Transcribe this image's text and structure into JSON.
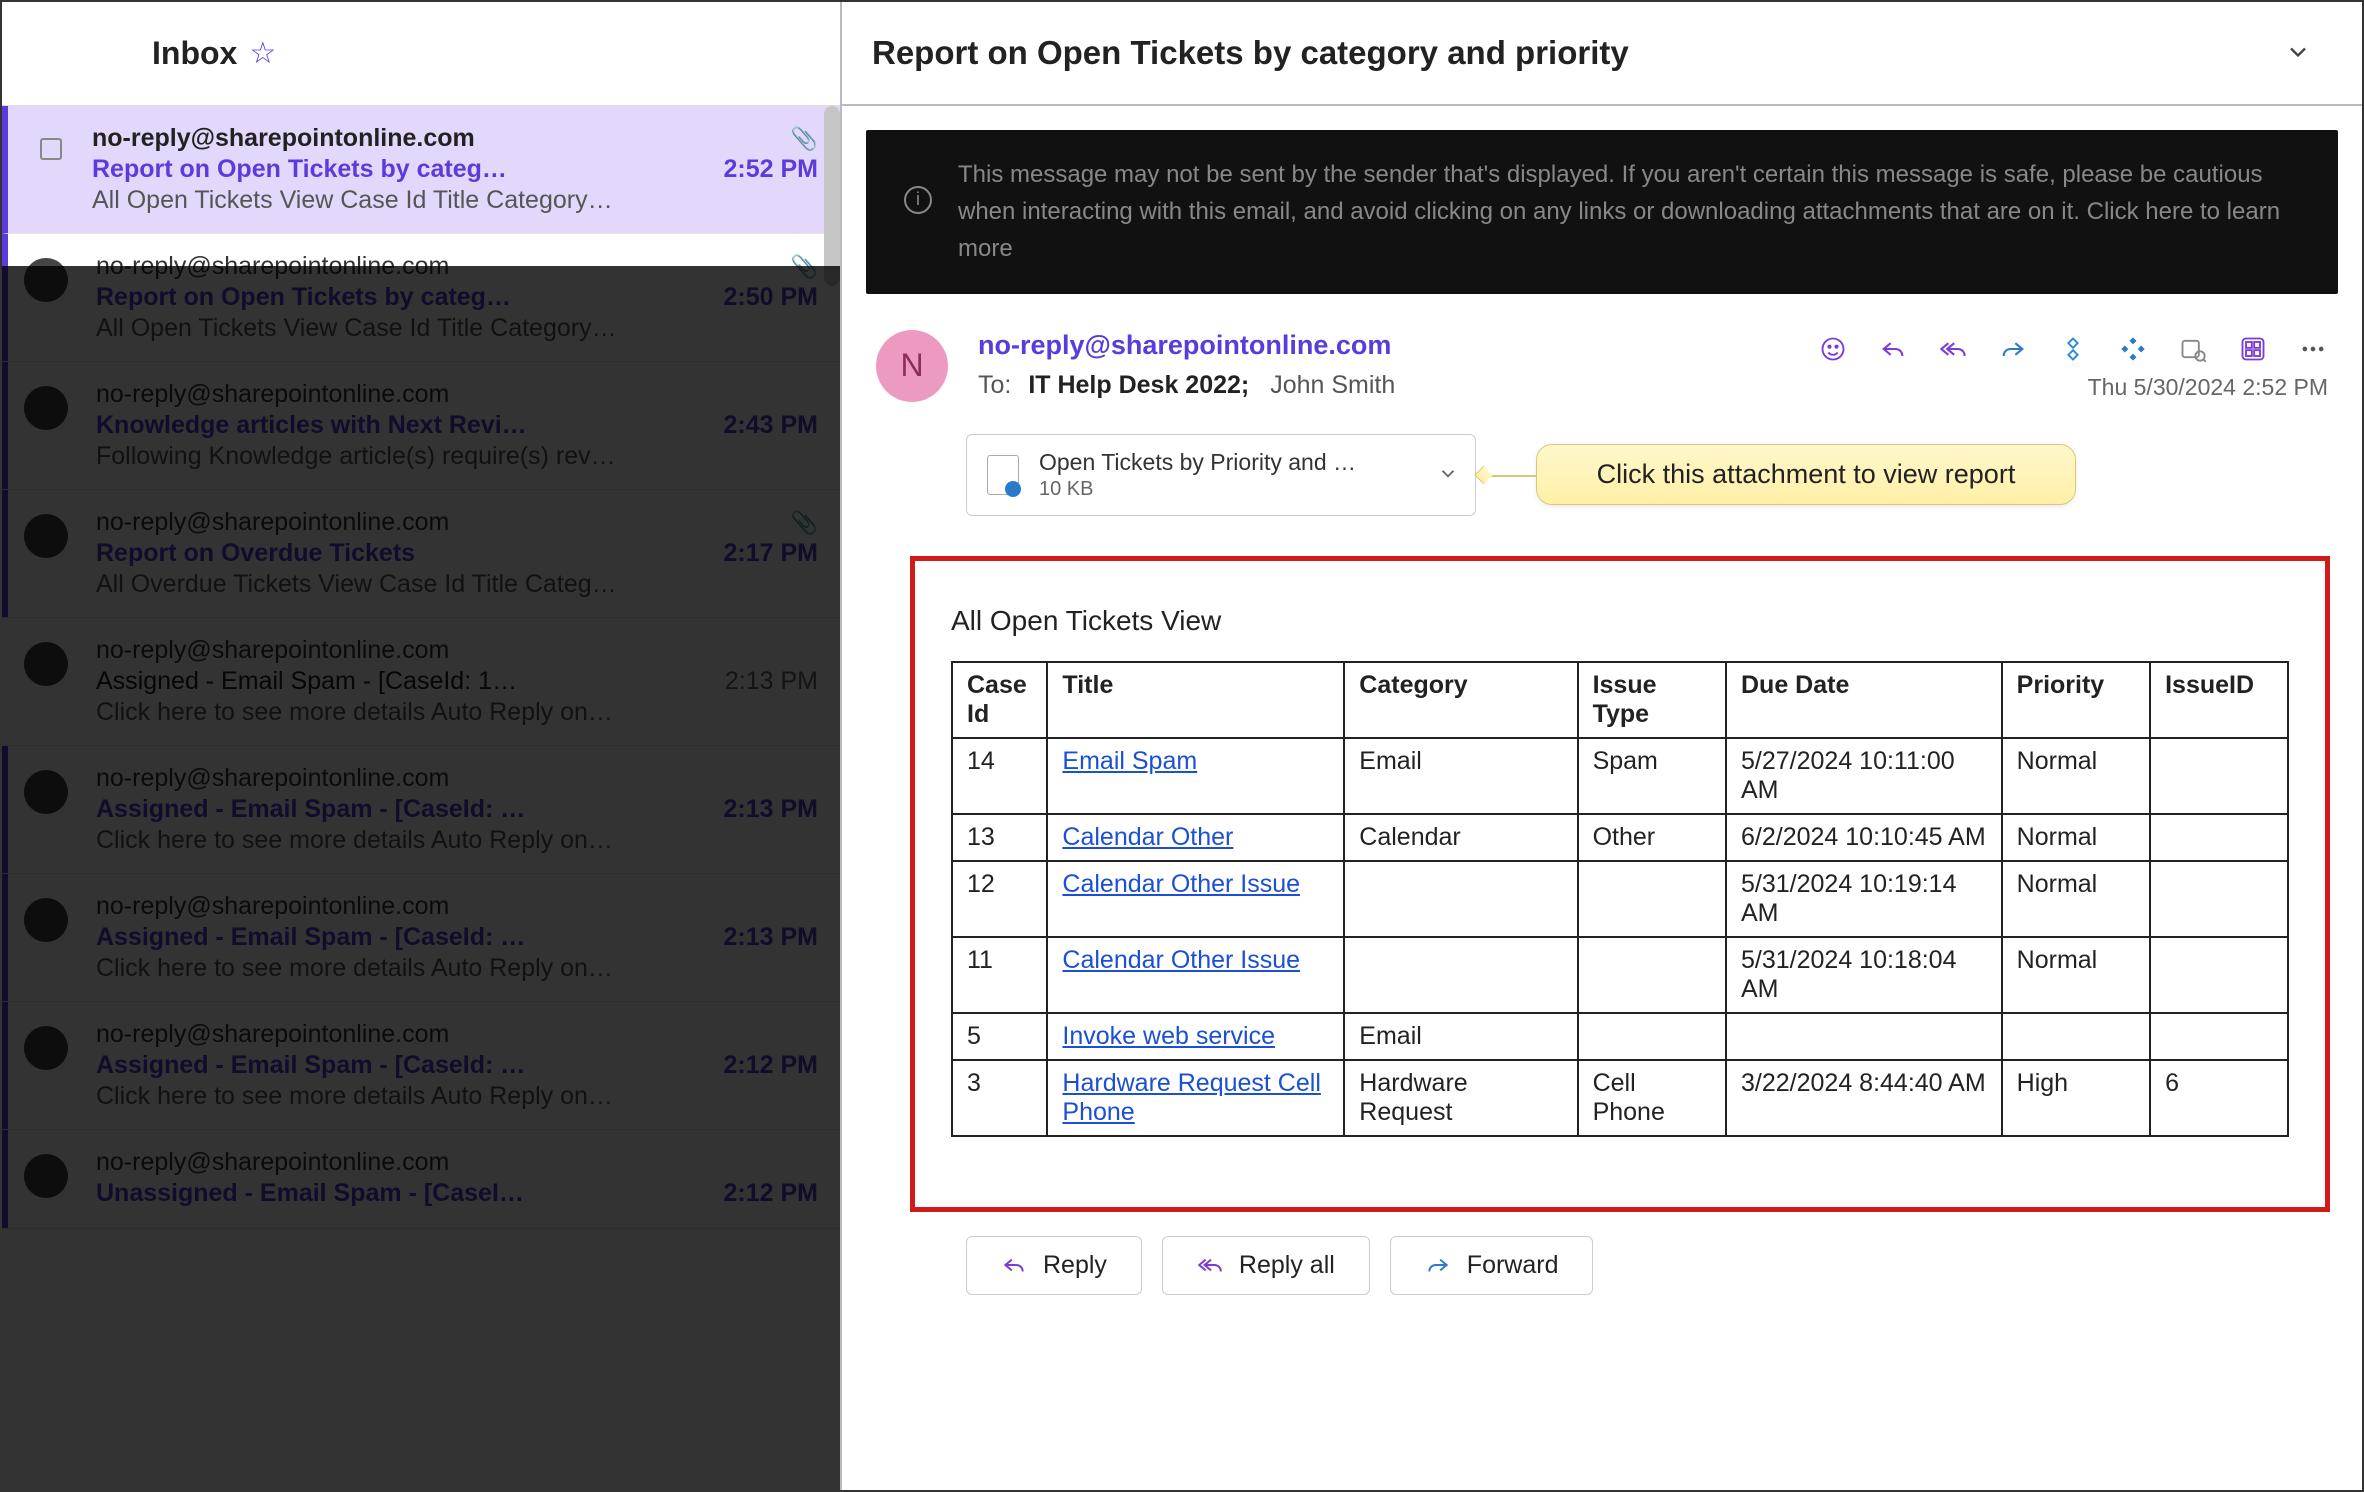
{
  "inbox": {
    "title": "Inbox",
    "items": [
      {
        "sender": "no-reply@sharepointonline.com",
        "subject": "Report on Open Tickets by categ…",
        "time": "2:52 PM",
        "preview": "All Open Tickets View Case Id Title Category…",
        "hasAttach": true,
        "selected": true,
        "unread": true
      },
      {
        "sender": "no-reply@sharepointonline.com",
        "subject": "Report on Open Tickets by categ…",
        "time": "2:50 PM",
        "preview": "All Open Tickets View Case Id Title Category…",
        "hasAttach": true,
        "selected": false,
        "unread": true
      },
      {
        "sender": "no-reply@sharepointonline.com",
        "subject": "Knowledge articles with Next Revi…",
        "time": "2:43 PM",
        "preview": "Following Knowledge article(s) require(s) rev…",
        "hasAttach": false,
        "selected": false,
        "unread": true
      },
      {
        "sender": "no-reply@sharepointonline.com",
        "subject": "Report on Overdue Tickets",
        "time": "2:17 PM",
        "preview": "All Overdue Tickets View Case Id Title Categ…",
        "hasAttach": true,
        "selected": false,
        "unread": true
      },
      {
        "sender": "no-reply@sharepointonline.com",
        "subject": "Assigned - Email Spam - [CaseId: 1…",
        "time": "2:13 PM",
        "preview": "Click here to see more details Auto Reply on…",
        "hasAttach": false,
        "selected": false,
        "unread": false
      },
      {
        "sender": "no-reply@sharepointonline.com",
        "subject": "Assigned - Email Spam - [CaseId: …",
        "time": "2:13 PM",
        "preview": "Click here to see more details Auto Reply on…",
        "hasAttach": false,
        "selected": false,
        "unread": true
      },
      {
        "sender": "no-reply@sharepointonline.com",
        "subject": "Assigned - Email Spam - [CaseId: …",
        "time": "2:13 PM",
        "preview": "Click here to see more details Auto Reply on…",
        "hasAttach": false,
        "selected": false,
        "unread": true
      },
      {
        "sender": "no-reply@sharepointonline.com",
        "subject": "Assigned - Email Spam - [CaseId: …",
        "time": "2:12 PM",
        "preview": "Click here to see more details Auto Reply on…",
        "hasAttach": false,
        "selected": false,
        "unread": true
      },
      {
        "sender": "no-reply@sharepointonline.com",
        "subject": "Unassigned - Email Spam - [CaseI…",
        "time": "2:12 PM",
        "preview": "",
        "hasAttach": false,
        "selected": false,
        "unread": true
      }
    ]
  },
  "reading": {
    "subject": "Report on Open Tickets by category and priority",
    "safety_banner": "This message may not be sent by the sender that's displayed. If you aren't certain this message is safe, please be cautious when interacting with this email, and avoid clicking on any links or downloading attachments that are on it.  Click here to learn more",
    "sender_initial": "N",
    "sender_addr": "no-reply@sharepointonline.com",
    "to_label": "To:",
    "to_primary": "IT Help Desk 2022;",
    "to_secondary": "John Smith",
    "timestamp": "Thu 5/30/2024 2:52 PM",
    "attachment": {
      "name": "Open Tickets by Priority and …",
      "size": "10 KB"
    },
    "callout": "Click this attachment to view report",
    "report_title": "All Open Tickets View",
    "table": {
      "headers": [
        "Case Id",
        "Title",
        "Category",
        "Issue Type",
        "Due Date",
        "Priority",
        "IssueID"
      ],
      "rows": [
        {
          "case_id": "14",
          "title": "Email Spam",
          "category": "Email",
          "issue_type": "Spam",
          "due": "5/27/2024 10:11:00 AM",
          "priority": "Normal",
          "issue_id": ""
        },
        {
          "case_id": "13",
          "title": "Calendar Other",
          "category": "Calendar",
          "issue_type": "Other",
          "due": "6/2/2024 10:10:45 AM",
          "priority": "Normal",
          "issue_id": ""
        },
        {
          "case_id": "12",
          "title": "Calendar Other Issue",
          "category": "",
          "issue_type": "",
          "due": "5/31/2024 10:19:14 AM",
          "priority": "Normal",
          "issue_id": ""
        },
        {
          "case_id": "11",
          "title": "Calendar Other Issue",
          "category": "",
          "issue_type": "",
          "due": "5/31/2024 10:18:04 AM",
          "priority": "Normal",
          "issue_id": ""
        },
        {
          "case_id": "5",
          "title": "Invoke web service",
          "category": "Email",
          "issue_type": "",
          "due": "",
          "priority": "",
          "issue_id": ""
        },
        {
          "case_id": "3",
          "title": "Hardware Request Cell Phone",
          "category": "Hardware Request",
          "issue_type": "Cell Phone",
          "due": "3/22/2024 8:44:40 AM",
          "priority": "High",
          "issue_id": "6"
        }
      ]
    },
    "actions": {
      "reply": "Reply",
      "reply_all": "Reply all",
      "forward": "Forward"
    }
  }
}
